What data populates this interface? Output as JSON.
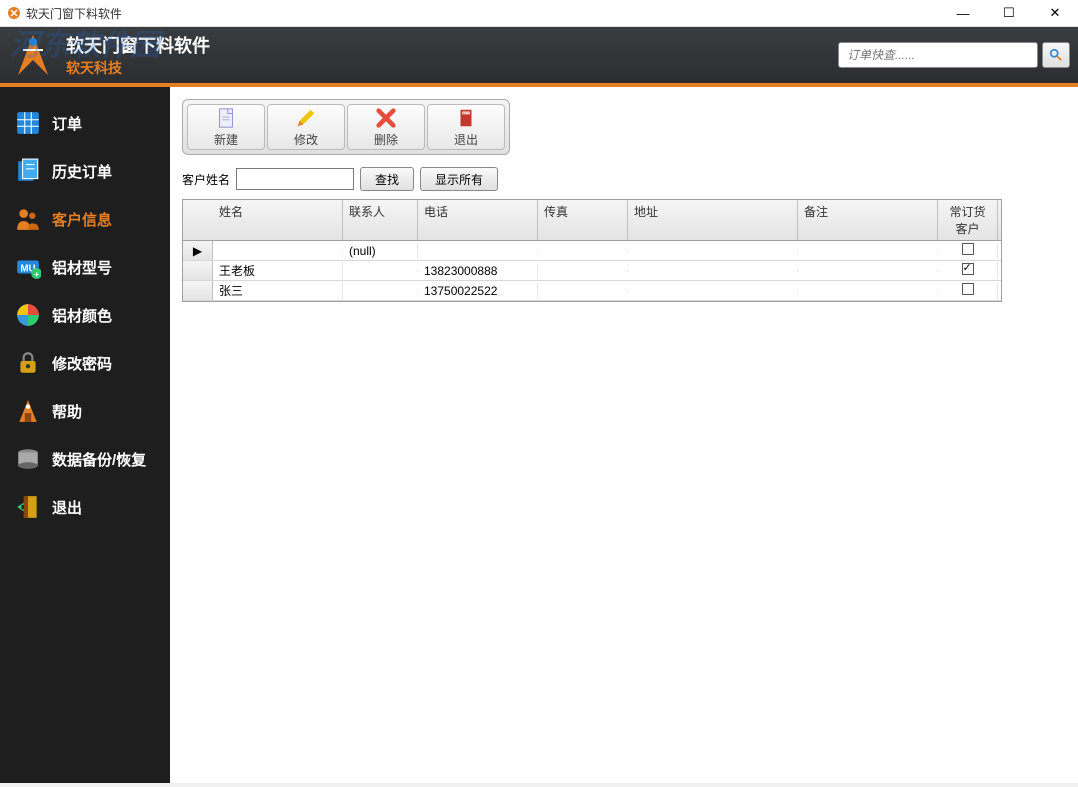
{
  "window": {
    "title": "软天门窗下料软件"
  },
  "watermark": "河东软件园",
  "header": {
    "title": "软天门窗下料软件",
    "subtitle": "软天科技",
    "search_placeholder": "订单快查......"
  },
  "sidebar": {
    "items": [
      {
        "label": "订单",
        "icon": "grid",
        "active": false
      },
      {
        "label": "历史订单",
        "icon": "docs",
        "active": false
      },
      {
        "label": "客户信息",
        "icon": "users",
        "active": true
      },
      {
        "label": "铝材型号",
        "icon": "material",
        "active": false
      },
      {
        "label": "铝材颜色",
        "icon": "color",
        "active": false
      },
      {
        "label": "修改密码",
        "icon": "lock",
        "active": false
      },
      {
        "label": "帮助",
        "icon": "help",
        "active": false
      },
      {
        "label": "数据备份/恢复",
        "icon": "backup",
        "active": false
      },
      {
        "label": "退出",
        "icon": "exit",
        "active": false
      }
    ]
  },
  "toolbar": {
    "new_label": "新建",
    "edit_label": "修改",
    "delete_label": "删除",
    "exit_label": "退出"
  },
  "filter": {
    "label": "客户姓名",
    "search_btn": "查找",
    "showall_btn": "显示所有"
  },
  "table": {
    "headers": {
      "name": "姓名",
      "contact": "联系人",
      "phone": "电话",
      "fax": "传真",
      "address": "地址",
      "remark": "备注",
      "frequent": "常订货客户"
    },
    "rows": [
      {
        "selector": "▶",
        "name": "",
        "contact": "(null)",
        "phone": "",
        "fax": "",
        "address": "",
        "remark": "",
        "frequent": false
      },
      {
        "selector": "",
        "name": "王老板",
        "contact": "",
        "phone": "13823000888",
        "fax": "",
        "address": "",
        "remark": "",
        "frequent": true
      },
      {
        "selector": "",
        "name": "张三",
        "contact": "",
        "phone": "13750022522",
        "fax": "",
        "address": "",
        "remark": "",
        "frequent": false
      }
    ]
  }
}
